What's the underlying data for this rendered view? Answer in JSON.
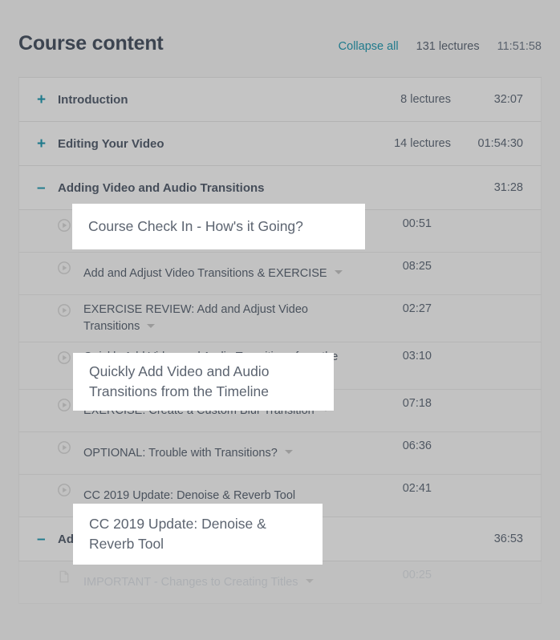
{
  "header": {
    "title": "Course content",
    "collapse_all_label": "Collapse all",
    "lecture_count": "131 lectures",
    "total_length": "11:51:58",
    "link_color": "#1f7a8c"
  },
  "sections": [
    {
      "toggle": "+",
      "title": "Introduction",
      "lectures": "8 lectures",
      "duration": "32:07",
      "expanded": false
    },
    {
      "toggle": "+",
      "title": "Editing Your Video",
      "lectures": "14 lectures",
      "duration": "01:54:30",
      "expanded": false
    },
    {
      "toggle": "–",
      "title": "Adding Video and Audio Transitions",
      "lectures": "",
      "duration": "31:28",
      "expanded": true
    },
    {
      "toggle": "–",
      "title": "Adding Titles in Premiere Pro",
      "lectures": "",
      "duration": "36:53",
      "expanded": true
    }
  ],
  "lectures": [
    {
      "icon": "play-circle-icon",
      "title": "Course Check In - How's it Going?",
      "duration": "00:51",
      "has_caret": false,
      "covered": true
    },
    {
      "icon": "play-circle-icon",
      "title": "Add and Adjust Video Transitions & EXERCISE",
      "duration": "08:25",
      "has_caret": true,
      "covered": false
    },
    {
      "icon": "play-circle-icon",
      "title": "EXERCISE REVIEW: Add and Adjust Video Transitions",
      "duration": "02:27",
      "has_caret": true,
      "covered": false
    },
    {
      "icon": "play-circle-icon",
      "title": "Quickly Add Video and Audio Transitions from the Timeline",
      "duration": "03:10",
      "has_caret": false,
      "covered": true
    },
    {
      "icon": "play-circle-icon",
      "title": "EXERCISE: Create a Custom Blur Transition",
      "duration": "07:18",
      "has_caret": true,
      "covered": false
    },
    {
      "icon": "play-circle-icon",
      "title": "OPTIONAL: Trouble with Transitions?",
      "duration": "06:36",
      "has_caret": true,
      "covered": false
    },
    {
      "icon": "play-circle-icon",
      "title": "CC 2019 Update: Denoise & Reverb Tool",
      "duration": "02:41",
      "has_caret": false,
      "covered": true
    }
  ],
  "lectures_section_two": [
    {
      "icon": "document-icon",
      "title": "IMPORTANT - Changes to Creating Titles",
      "duration": "00:25",
      "has_caret": true
    }
  ],
  "highlight_boxes": [
    {
      "text": "Course Check In - How's it Going?"
    },
    {
      "text": "Quickly Add Video and Audio Transitions from the Timeline"
    },
    {
      "text": "CC 2019 Update: Denoise & Reverb Tool"
    }
  ]
}
